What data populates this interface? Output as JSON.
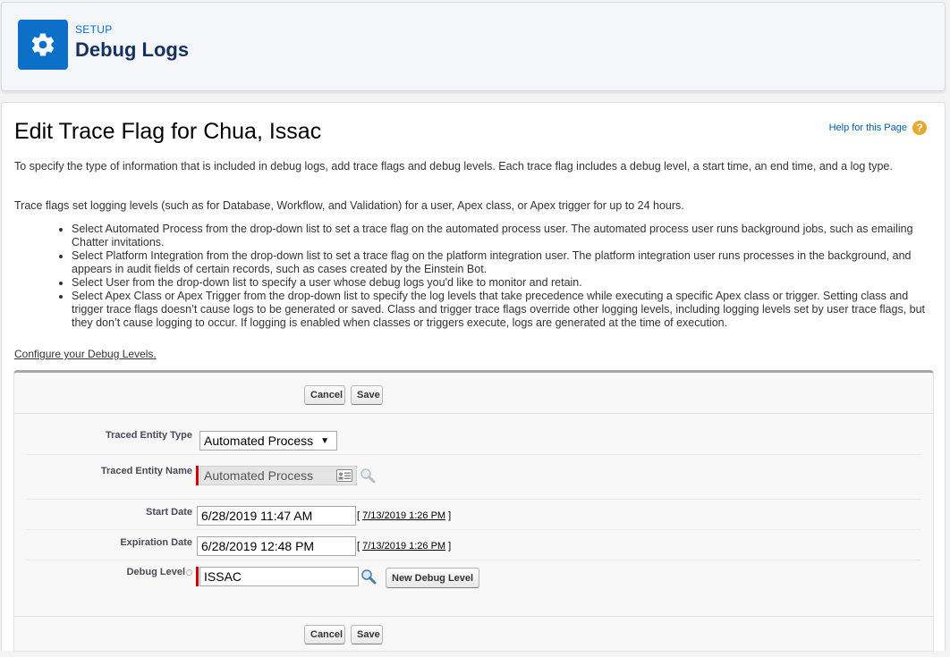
{
  "header": {
    "eyebrow": "SETUP",
    "title": "Debug Logs",
    "icon": "gear-icon",
    "accent": "#0c70c8"
  },
  "page": {
    "title": "Edit Trace Flag for Chua, Issac",
    "help_link": "Help for this Page",
    "intro_1": "To specify the type of information that is included in debug logs, add trace flags and debug levels. Each trace flag includes a debug level, a start time, an end time, and a log type.",
    "intro_2": "Trace flags set logging levels (such as for Database, Workflow, and Validation) for a user, Apex class, or Apex trigger for up to 24 hours.",
    "bullets": [
      "Select Automated Process from the drop-down list to set a trace flag on the automated process user. The automated process user runs background jobs, such as emailing Chatter invitations.",
      "Select Platform Integration from the drop-down list to set a trace flag on the platform integration user. The platform integration user runs processes in the background, and appears in audit fields of certain records, such as cases created by the Einstein Bot.",
      "Select User from the drop-down list to specify a user whose debug logs you'd like to monitor and retain.",
      "Select Apex Class or Apex Trigger from the drop-down list to specify the log levels that take precedence while executing a specific Apex class or trigger. Setting class and trigger trace flags doesn’t cause logs to be generated or saved. Class and trigger trace flags override other logging levels, including logging levels set by user trace flags, but they don’t cause logging to occur. If logging is enabled when classes or triggers execute, logs are generated at the time of execution."
    ],
    "configure_link": "Configure your Debug Levels."
  },
  "form": {
    "cancel_label": "Cancel",
    "save_label": "Save",
    "traced_entity_type": {
      "label": "Traced Entity Type",
      "value": "Automated Process"
    },
    "traced_entity_name": {
      "label": "Traced Entity Name",
      "value": "Automated Process"
    },
    "start_date": {
      "label": "Start Date",
      "value": "6/28/2019 11:47 AM",
      "now_link": "7/13/2019 1:26 PM"
    },
    "expiration_date": {
      "label": "Expiration Date",
      "value": "6/28/2019 12:48 PM",
      "now_link": "7/13/2019 1:26 PM"
    },
    "debug_level": {
      "label": "Debug Level",
      "value": "ISSAC",
      "new_button": "New Debug Level"
    }
  }
}
